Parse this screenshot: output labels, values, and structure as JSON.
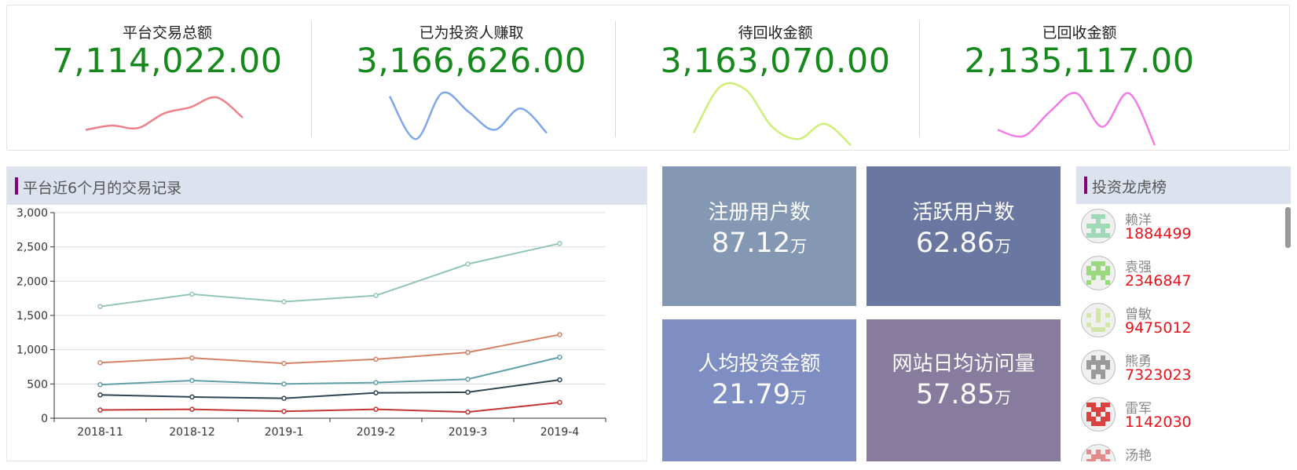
{
  "stats": [
    {
      "label": "平台交易总额",
      "value": "7,114,022.00",
      "spark_color": "#ee8089",
      "spark": [
        0.25,
        0.32,
        0.28,
        0.52,
        0.62,
        0.78,
        0.45
      ]
    },
    {
      "label": "已为投资人赚取",
      "value": "3,166,626.00",
      "spark_color": "#7ea7ea",
      "spark": [
        0.8,
        0.1,
        0.85,
        0.55,
        0.25,
        0.6,
        0.2
      ]
    },
    {
      "label": "待回收金额",
      "value": "3,163,070.00",
      "spark_color": "#cfee79",
      "spark": [
        0.2,
        0.95,
        0.9,
        0.3,
        0.1,
        0.35,
        0.0
      ]
    },
    {
      "label": "已回收金额",
      "value": "2,135,117.00",
      "spark_color": "#f27ce6",
      "spark": [
        0.25,
        0.15,
        0.55,
        0.85,
        0.3,
        0.85,
        0.0
      ]
    }
  ],
  "chart_panel": {
    "title": "平台近6个月的交易记录"
  },
  "chart_data": {
    "type": "line",
    "categories": [
      "2018-11",
      "2018-12",
      "2019-1",
      "2019-2",
      "2019-3",
      "2019-4"
    ],
    "ylim": [
      0,
      3000
    ],
    "yticks": [
      "0",
      "500",
      "1,000",
      "1,500",
      "2,000",
      "2,500",
      "3,000"
    ],
    "grid": true,
    "series": [
      {
        "color": "#91c7ae",
        "values": [
          1630,
          1810,
          1700,
          1790,
          2250,
          2550
        ]
      },
      {
        "color": "#d48265",
        "values": [
          810,
          880,
          800,
          860,
          960,
          1220
        ]
      },
      {
        "color": "#61a0a8",
        "values": [
          490,
          550,
          500,
          520,
          570,
          890
        ]
      },
      {
        "color": "#2f4554",
        "values": [
          340,
          310,
          290,
          370,
          380,
          560
        ]
      },
      {
        "color": "#c23531",
        "values": [
          120,
          130,
          100,
          130,
          90,
          230
        ]
      }
    ]
  },
  "tiles": [
    {
      "title": "注册用户数",
      "value": "87.12",
      "unit": "万",
      "color": "#8498b4"
    },
    {
      "title": "活跃用户数",
      "value": "62.86",
      "unit": "万",
      "color": "#6a77a1"
    },
    {
      "title": "人均投资金额",
      "value": "21.79",
      "unit": "万",
      "color": "#7f8ec2"
    },
    {
      "title": "网站日均访问量",
      "value": "57.85",
      "unit": "万",
      "color": "#877b9e"
    }
  ],
  "ranking": {
    "title": "投资龙虎榜",
    "items": [
      {
        "name": "赖洋",
        "value": "1884499",
        "color": "#9fd9b8"
      },
      {
        "name": "袁强",
        "value": "2346847",
        "color": "#9bd87f"
      },
      {
        "name": "曾敏",
        "value": "9475012",
        "color": "#d3e6a8"
      },
      {
        "name": "熊勇",
        "value": "7323023",
        "color": "#9a9a9a"
      },
      {
        "name": "雷军",
        "value": "1142030",
        "color": "#d9423f"
      },
      {
        "name": "汤艳",
        "value": "",
        "color": "#e58a8a"
      }
    ]
  }
}
